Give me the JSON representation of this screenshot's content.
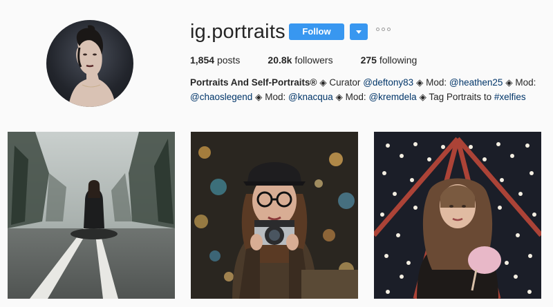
{
  "profile": {
    "username": "ig.portraits",
    "follow_label": "Follow",
    "posts_count": "1,854",
    "posts_label": "posts",
    "followers_count": "20.8k",
    "followers_label": "followers",
    "following_count": "275",
    "following_label": "following"
  },
  "bio": {
    "title": "Portraits And Self-Portraits®",
    "curator_label": "Curator",
    "curator": "@deftony83",
    "mod_label": "Mod:",
    "mod1": "@heathen25",
    "mod2": "@chaoslegend",
    "mod3": "@knacqua",
    "mod4": "@kremdela",
    "tag_text": "Tag Portraits to",
    "hashtag": "#xelfies",
    "separator": "◈"
  },
  "colors": {
    "accent": "#3897f0",
    "link": "#003569",
    "background": "#fafafa"
  },
  "icons": {
    "dropdown": "chevron-down-icon",
    "more": "more-options-icon"
  },
  "posts": [
    {
      "label": "woman sitting on foggy road"
    },
    {
      "label": "girl holding camera with bokeh lights"
    },
    {
      "label": "curly-haired woman with cotton candy at ferris wheel"
    }
  ]
}
